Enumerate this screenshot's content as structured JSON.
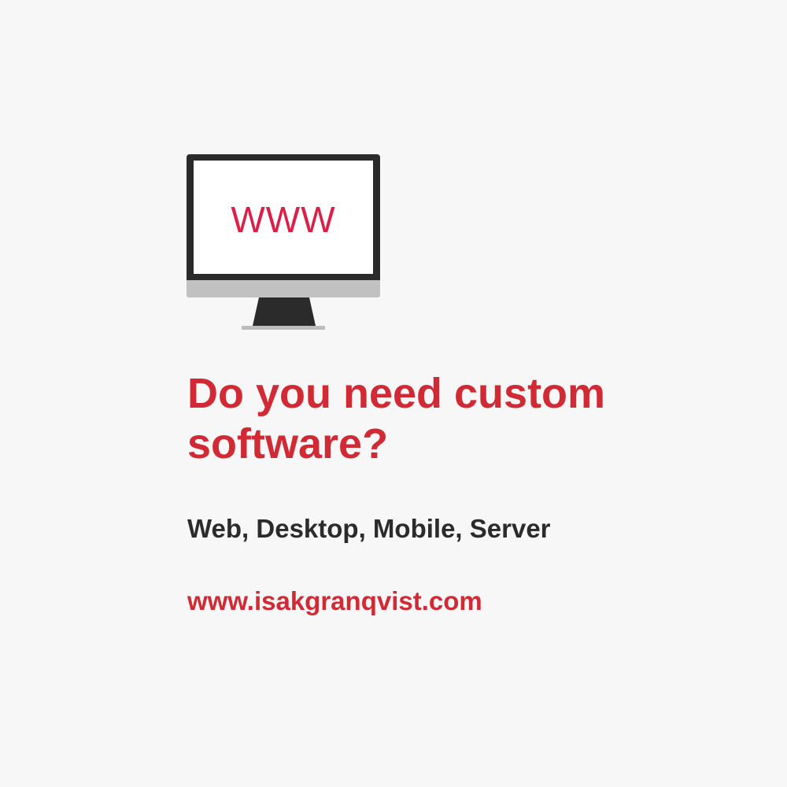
{
  "monitor": {
    "screen_text": "WWW",
    "icon": "desktop-monitor-icon"
  },
  "headline": {
    "line1": "Do you need custom",
    "line2": "software?"
  },
  "tagline": "Web, Desktop, Mobile, Server",
  "website": "www.isakgranqvist.com",
  "colors": {
    "background": "#f7f7f7",
    "accent": "#d12a35",
    "screen_text": "#dc1f47",
    "text_dark": "#2b2b2b",
    "monitor_frame": "#2b2b2b",
    "monitor_chin": "#c1c1c1"
  }
}
